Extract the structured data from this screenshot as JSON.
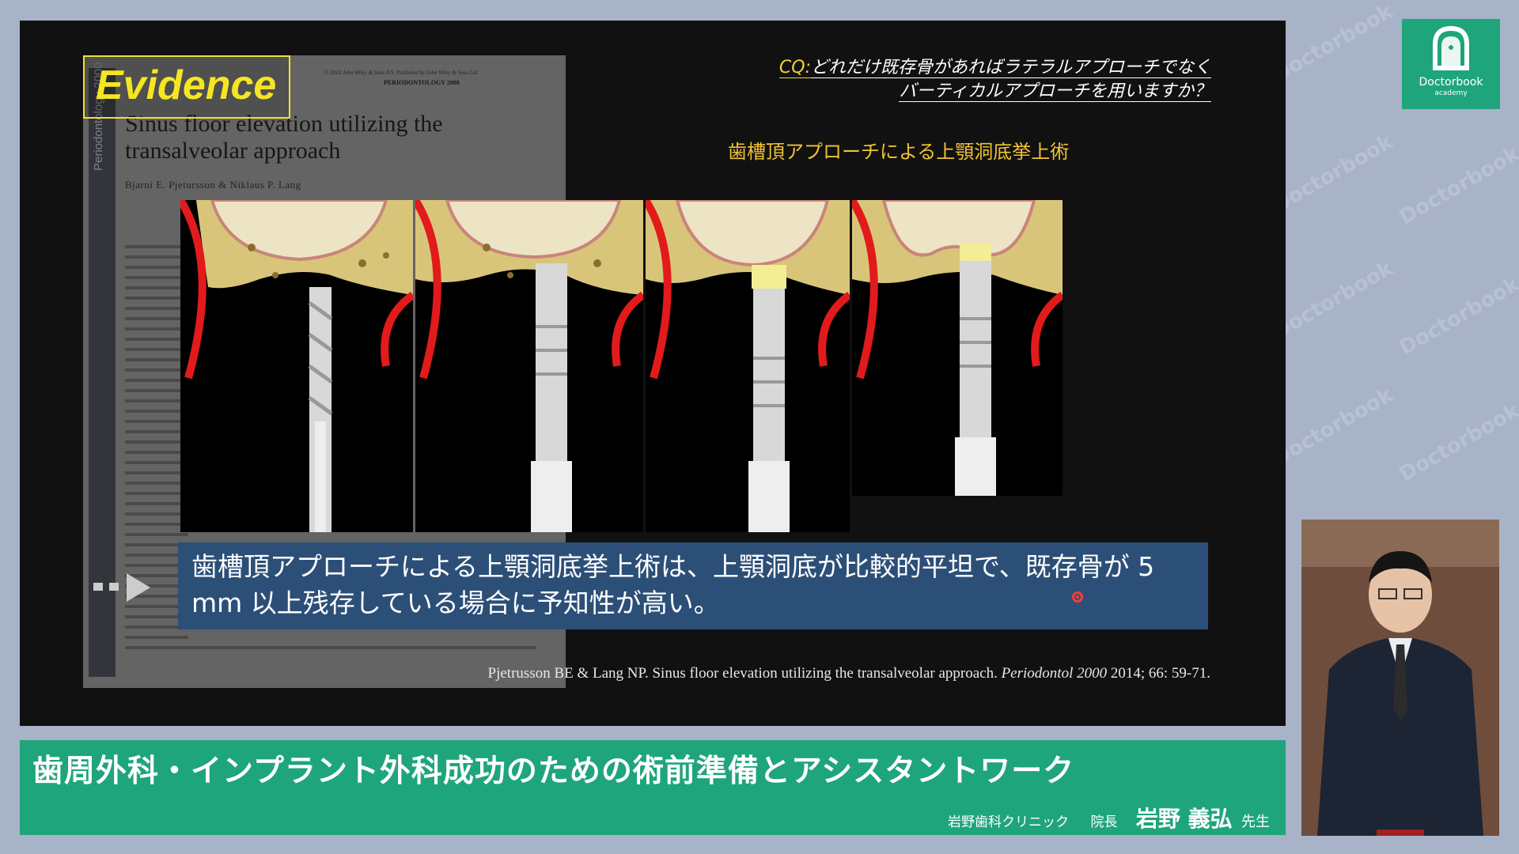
{
  "brand": {
    "line1": "Doctorbook",
    "line2": "academy",
    "watermark": "Doctorbook",
    "watermark_sub": "academy"
  },
  "slide": {
    "badge": "Evidence",
    "paper": {
      "header": "© 2014 John Wiley & Sons A/S. Published by John Wiley & Sons Ltd",
      "journal": "PERIODONTOLOGY 2000",
      "title": "Sinus floor elevation utilizing the transalveolar approach",
      "authors": "Bjarni E. Pjetursson & Niklaus P. Lang",
      "spine": "Periodontology 2000"
    },
    "cq": {
      "prefix": "CQ:",
      "line1": "どれだけ既存骨があればラテラルアプローチでなく",
      "line2": "バーティカルアプローチを用いますか？"
    },
    "caption": "歯槽頂アプローチによる上顎洞底挙上術",
    "explanation": "歯槽頂アプローチによる上顎洞底挙上術は、上顎洞底が比較的平坦で、既存骨が 5 mm 以上残存している場合に予知性が高い。",
    "reference": {
      "main": "Pjetrusson BE & Lang NP. Sinus floor elevation utilizing the transalveolar approach. ",
      "journal": "Periodontol 2000",
      "tail": " 2014; 66: 59-71."
    }
  },
  "banner": {
    "title": "歯周外科・インプラント外科成功のための術前準備とアシスタントワーク",
    "clinic": "岩野歯科クリニック",
    "role": "院長",
    "name": "岩野 義弘",
    "honorific": "先生"
  },
  "colors": {
    "banner": "#1fa57b",
    "badge": "#f5e622",
    "caption": "#f1c233",
    "explain_bg": "#2c4f78"
  }
}
